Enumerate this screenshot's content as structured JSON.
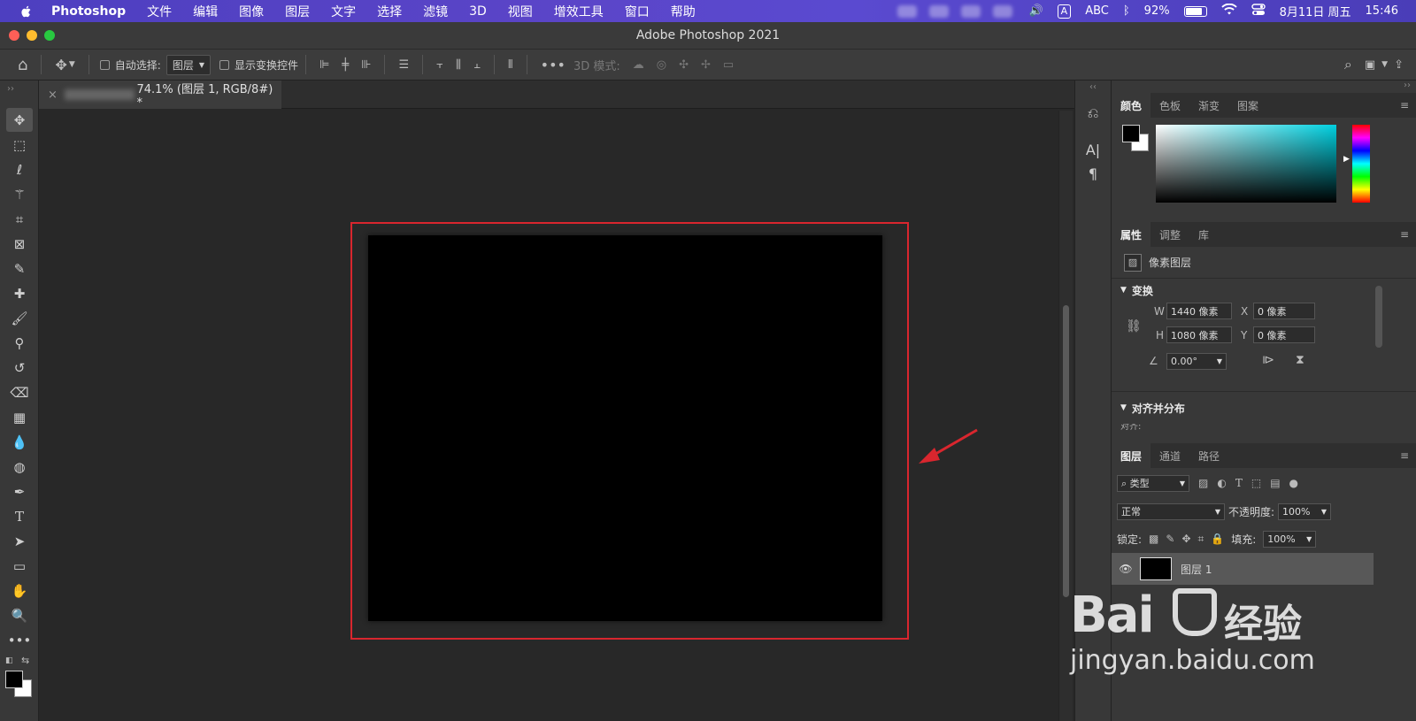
{
  "menubar": {
    "app_name": "Photoshop",
    "items": [
      "文件",
      "编辑",
      "图像",
      "图层",
      "文字",
      "选择",
      "滤镜",
      "3D",
      "视图",
      "增效工具",
      "窗口",
      "帮助"
    ],
    "input_method": "A",
    "input_label": "ABC",
    "battery": "92%",
    "date": "8月11日 周五",
    "time": "15:46"
  },
  "window": {
    "title": "Adobe Photoshop 2021"
  },
  "options_bar": {
    "auto_select_label": "自动选择:",
    "auto_select_value": "图层",
    "show_transform_label": "显示变换控件",
    "mode_3d_label": "3D 模式:"
  },
  "document": {
    "tab_title": "74.1% (图层 1, RGB/8#) *"
  },
  "color_panel": {
    "tabs": [
      "颜色",
      "色板",
      "渐变",
      "图案"
    ]
  },
  "properties_panel": {
    "tabs": [
      "属性",
      "调整",
      "库"
    ],
    "layer_type": "像素图层",
    "transform_title": "变换",
    "w_label": "W",
    "w_value": "1440 像素",
    "x_label": "X",
    "x_value": "0 像素",
    "h_label": "H",
    "h_value": "1080 像素",
    "y_label": "Y",
    "y_value": "0 像素",
    "angle_value": "0.00°",
    "align_title": "对齐并分布",
    "align_sub": "对齐:"
  },
  "layers_panel": {
    "tabs": [
      "图层",
      "通道",
      "路径"
    ],
    "filter_type": "类型",
    "blend_mode": "正常",
    "opacity_label": "不透明度:",
    "opacity_value": "100%",
    "lock_label": "锁定:",
    "fill_label": "填充:",
    "fill_value": "100%",
    "layer_name": "图层 1"
  },
  "watermark": {
    "brand": "Bai",
    "brand_suffix": "经验",
    "url": "jingyan.baidu.com"
  },
  "colors": {
    "menubar": "#5044c4",
    "highlight_box": "#d9262e"
  }
}
